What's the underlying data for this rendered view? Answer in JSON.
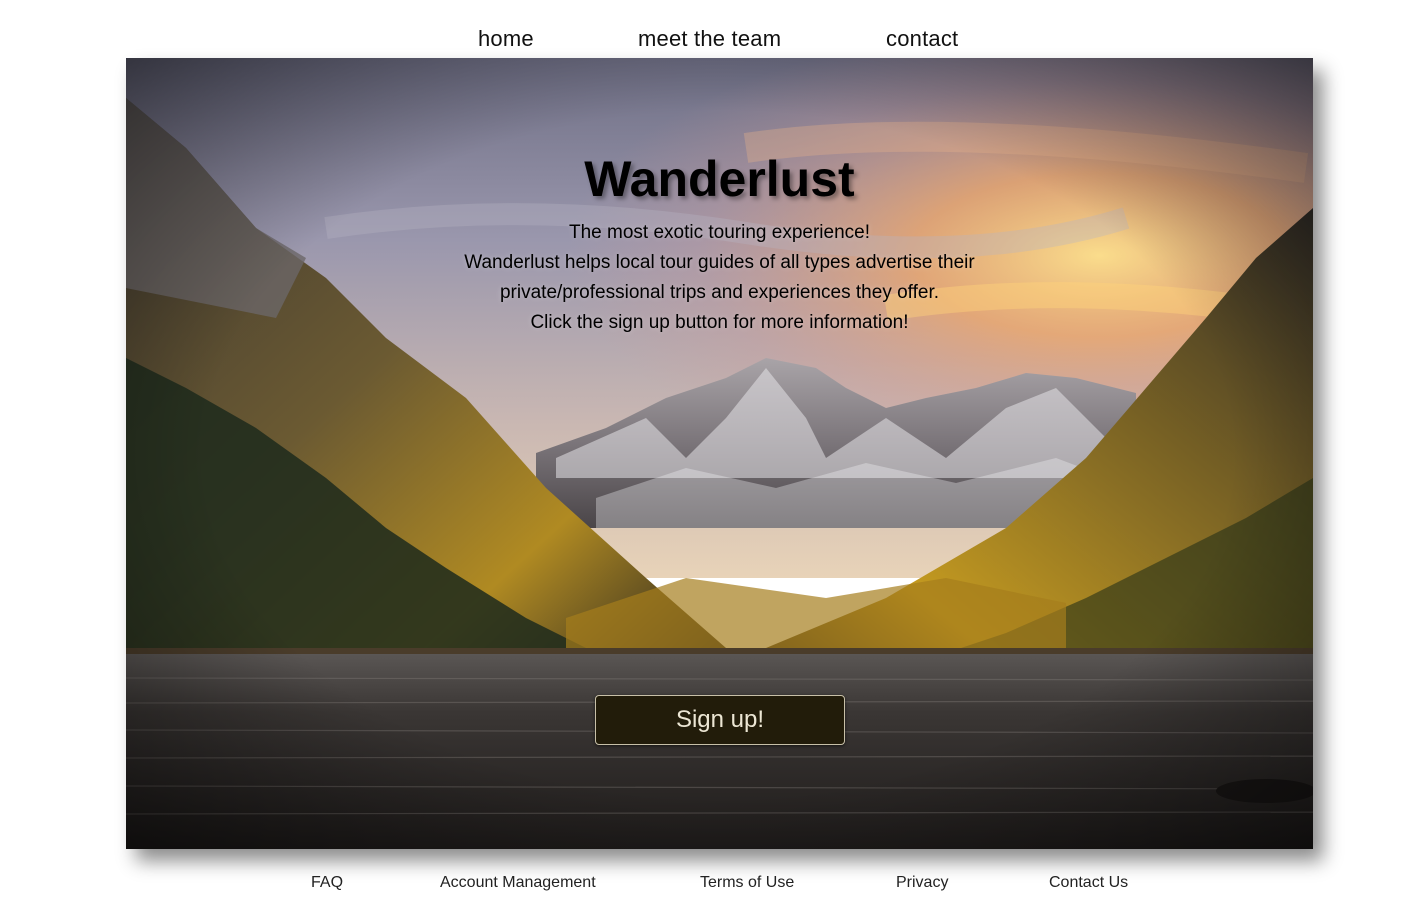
{
  "nav": {
    "items": [
      {
        "label": "home"
      },
      {
        "label": "meet the team"
      },
      {
        "label": "contact"
      }
    ]
  },
  "hero": {
    "title": "Wanderlust",
    "lines": [
      "The most exotic touring experience!",
      "Wanderlust helps local tour guides of all types advertise their",
      "private/professional trips and experiences they offer.",
      "Click the sign up button for more information!"
    ],
    "signup_label": "Sign up!",
    "background": {
      "subject": "mountain-lake-landscape",
      "sky_top": "#7f7f95",
      "sunset_glow": "#f4b46a",
      "forest_gold": "#c99a1e",
      "water": "#2b2a2a"
    }
  },
  "footer": {
    "links": [
      {
        "label": "FAQ"
      },
      {
        "label": "Account Management"
      },
      {
        "label": "Terms of Use"
      },
      {
        "label": "Privacy"
      },
      {
        "label": "Contact Us"
      }
    ]
  },
  "colors": {
    "button_bg": "#221c0a",
    "button_text": "#ece6d4"
  }
}
